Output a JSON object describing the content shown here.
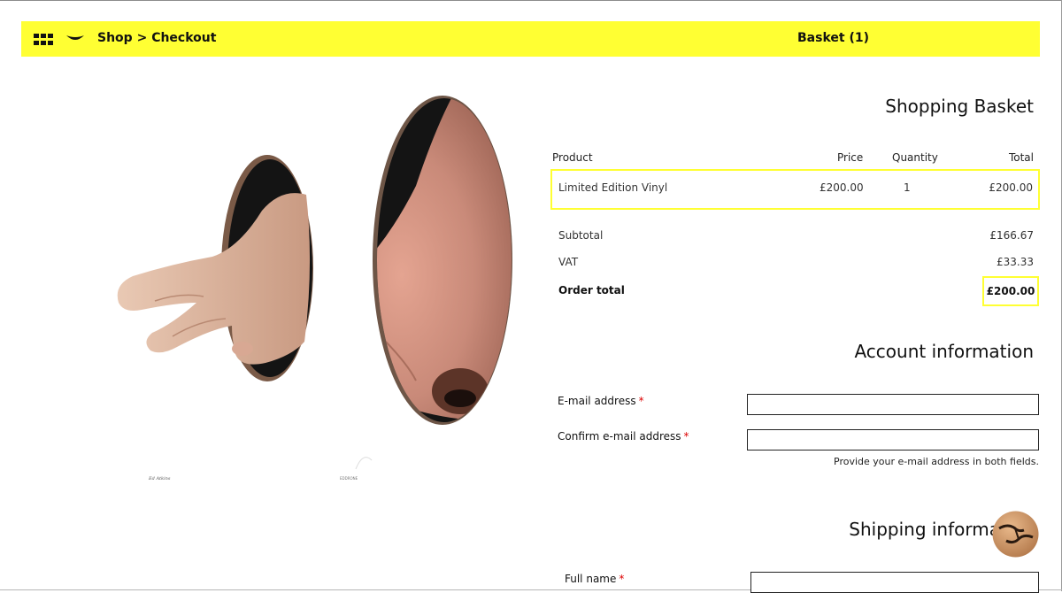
{
  "header": {
    "breadcrumb": {
      "shop": "Shop",
      "separator": ">",
      "current": "Checkout"
    },
    "basket_label": "Basket (1)",
    "accent_color": "#ffff33"
  },
  "art": {
    "signature": "Ed Atkins",
    "small_text": "EDDRONE"
  },
  "basket": {
    "title": "Shopping Basket",
    "columns": {
      "product": "Product",
      "price": "Price",
      "quantity": "Quantity",
      "total": "Total"
    },
    "items": [
      {
        "product": "Limited Edition Vinyl",
        "price": "£200.00",
        "quantity": "1",
        "total": "£200.00"
      }
    ],
    "summary": {
      "subtotal_label": "Subtotal",
      "subtotal_value": "£166.67",
      "vat_label": "VAT",
      "vat_value": "£33.33",
      "order_total_label": "Order total",
      "order_total_value": "£200.00"
    }
  },
  "account": {
    "title": "Account information",
    "email_label": "E-mail address",
    "confirm_email_label": "Confirm e-mail address",
    "required_mark": "*",
    "hint": "Provide your e-mail address in both fields."
  },
  "shipping": {
    "title": "Shipping informa",
    "full_name_label": "Full name",
    "required_mark": "*"
  }
}
